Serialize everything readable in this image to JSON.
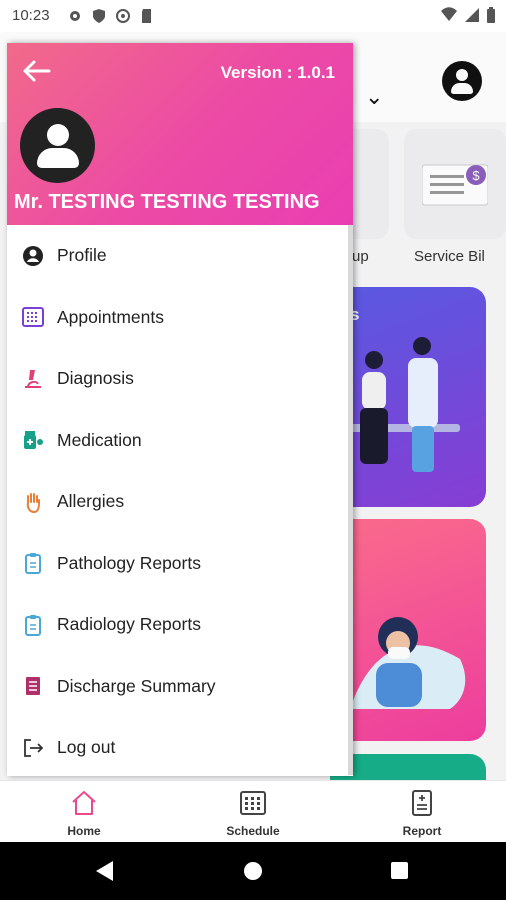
{
  "status_bar": {
    "time": "10:23",
    "left_icons": [
      "gear-icon",
      "shield-icon",
      "vpn-icon",
      "sd-card-icon"
    ],
    "right_icons": [
      "wifi-icon",
      "signal-icon",
      "battery-icon"
    ]
  },
  "background": {
    "tiles": [
      {
        "label": "up",
        "icon": "shield-check-icon"
      },
      {
        "label": "Service Bil",
        "icon": "bill-icon"
      }
    ],
    "cards": [
      {
        "title": "s",
        "color": "#6a4be0",
        "illustration": "doctor-patient-illustration"
      },
      {
        "title": "",
        "color": "#f2509a",
        "illustration": "sick-woman-illustration"
      },
      {
        "title": "",
        "color": "#17b08a"
      }
    ]
  },
  "drawer": {
    "version": "Version : 1.0.1",
    "user_name": "Mr. TESTING TESTING TESTING",
    "header_color": "#ec4aa5",
    "menu": [
      {
        "label": "Profile",
        "icon": "profile-icon",
        "color": "#222222"
      },
      {
        "label": "Appointments",
        "icon": "calendar-icon",
        "color": "#7a3fd8"
      },
      {
        "label": "Diagnosis",
        "icon": "microscope-icon",
        "color": "#e0407a"
      },
      {
        "label": "Medication",
        "icon": "medicine-icon",
        "color": "#17a08a"
      },
      {
        "label": "Allergies",
        "icon": "hand-icon",
        "color": "#e8803a"
      },
      {
        "label": "Pathology Reports",
        "icon": "clipboard-icon",
        "color": "#4aa8d8"
      },
      {
        "label": "Radiology Reports",
        "icon": "clipboard-icon",
        "color": "#4aa8d8"
      },
      {
        "label": "Discharge Summary",
        "icon": "document-icon",
        "color": "#b0306a"
      },
      {
        "label": "Log out",
        "icon": "logout-icon",
        "color": "#333333"
      }
    ]
  },
  "bottom_nav": [
    {
      "label": "Home",
      "icon": "home-icon",
      "active": true
    },
    {
      "label": "Schedule",
      "icon": "calendar-grid-icon",
      "active": false
    },
    {
      "label": "Report",
      "icon": "report-icon",
      "active": false
    }
  ]
}
